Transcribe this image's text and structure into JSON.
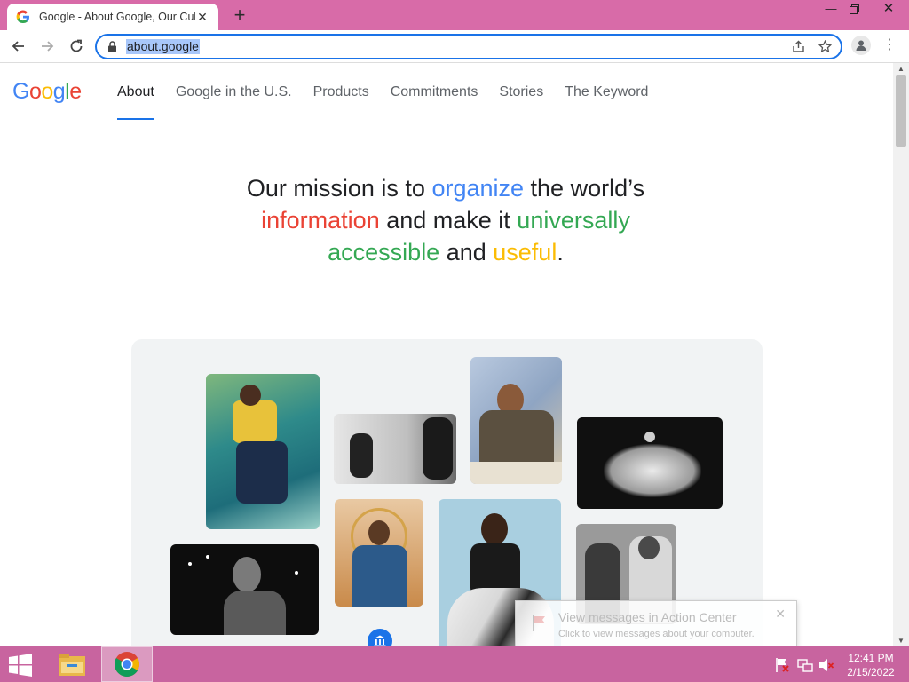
{
  "browser": {
    "tab_title": "Google - About Google, Our Cult",
    "url": "about.google",
    "new_tab_label": "+"
  },
  "page": {
    "logo_text": "Google",
    "nav": [
      {
        "label": "About",
        "active": true
      },
      {
        "label": "Google in the U.S.",
        "active": false
      },
      {
        "label": "Products",
        "active": false
      },
      {
        "label": "Commitments",
        "active": false
      },
      {
        "label": "Stories",
        "active": false
      },
      {
        "label": "The Keyword",
        "active": false
      }
    ],
    "mission": {
      "p1": "Our mission is to ",
      "w_organize": "organize",
      "p2": " the world’s",
      "w_information": "information",
      "p3": " and make it ",
      "w_universally": "universally",
      "w_accessible": "accessible",
      "p4": " and ",
      "w_useful": "useful",
      "p5": "."
    }
  },
  "notification": {
    "title": "View messages in Action Center",
    "body": "Click to view messages about your computer."
  },
  "taskbar": {
    "time": "12:41 PM",
    "date": "2/15/2022"
  },
  "colors": {
    "blue": "#4285f4",
    "red": "#ea4335",
    "yellow": "#fbbc04",
    "green": "#34a853",
    "titlebar": "#d86ba8",
    "taskbar": "#c8649f"
  }
}
